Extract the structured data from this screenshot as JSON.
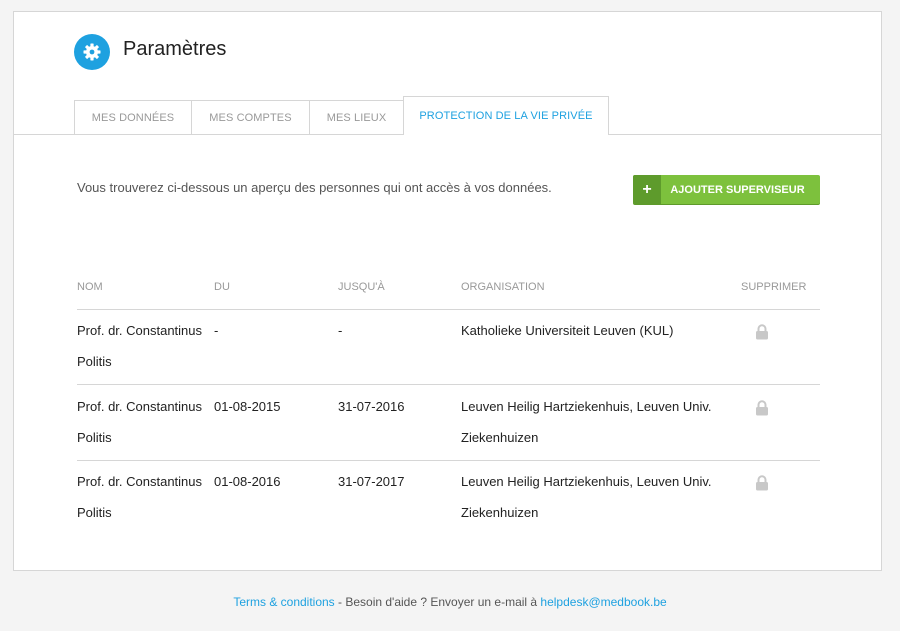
{
  "header": {
    "title": "Paramètres"
  },
  "tabs": [
    {
      "label": "MES DONNÉES"
    },
    {
      "label": "MES COMPTES"
    },
    {
      "label": "MES LIEUX"
    },
    {
      "label": "PROTECTION DE LA VIE PRIVÉE",
      "active": true
    }
  ],
  "intro": "Vous trouverez ci-dessous un aperçu des personnes qui ont accès à vos données.",
  "add_button": {
    "plus": "+",
    "label": "AJOUTER SUPERVISEUR"
  },
  "table": {
    "headers": {
      "name": "NOM",
      "from": "DU",
      "until": "JUSQU'À",
      "organisation": "ORGANISATION",
      "delete": "SUPPRIMER"
    },
    "rows": [
      {
        "name_line1": "Prof. dr. Constantinus",
        "name_line2": "Politis",
        "from": "-",
        "until": "-",
        "org_line1": "Katholieke Universiteit Leuven (KUL)",
        "org_line2": ""
      },
      {
        "name_line1": "Prof. dr. Constantinus",
        "name_line2": "Politis",
        "from": "01-08-2015",
        "until": "31-07-2016",
        "org_line1": "Leuven Heilig Hartziekenhuis, Leuven Univ.",
        "org_line2": "Ziekenhuizen"
      },
      {
        "name_line1": "Prof. dr. Constantinus",
        "name_line2": "Politis",
        "from": "01-08-2016",
        "until": "31-07-2017",
        "org_line1": "Leuven Heilig Hartziekenhuis, Leuven Univ.",
        "org_line2": "Ziekenhuizen"
      }
    ]
  },
  "footer": {
    "terms": "Terms & conditions",
    "help_text": " - Besoin d'aide ? Envoyer un e-mail à ",
    "email": "helpdesk@medbook.be"
  },
  "colors": {
    "accent": "#1ea1e0",
    "button": "#7dc13d",
    "button_dark": "#5e9b2c",
    "lock": "#c8c8c8"
  },
  "icons": {
    "settings": "gear-icon",
    "add": "plus-icon",
    "delete": "lock-icon"
  }
}
